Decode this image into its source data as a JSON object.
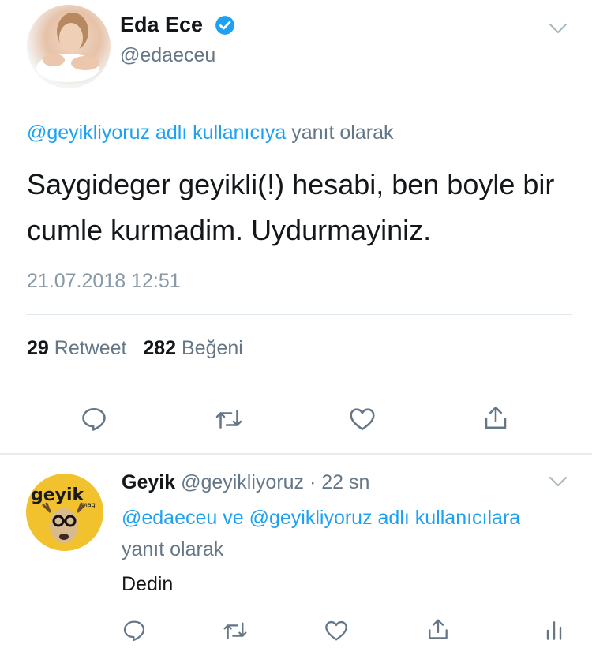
{
  "tweet": {
    "author_name": "Eda Ece",
    "author_handle": "@edaeceu",
    "reply_context_mention": "@geyikliyoruz adlı kullanıcıya",
    "reply_context_suffix": " yanıt olarak",
    "text": "Saygideger geyikli(!) hesabi, ben boyle bir cumle kurmadim. Uydurmayiniz.",
    "timestamp": "21.07.2018 12:51",
    "retweet_count": "29",
    "retweet_label": "Retweet",
    "like_count": "282",
    "like_label": "Beğeni",
    "actions": [
      "reply-icon",
      "retweet-icon",
      "like-icon",
      "share-icon"
    ]
  },
  "reply": {
    "author_name": "Geyik",
    "author_handle": "@geyikliyoruz",
    "time": "· 22 sn",
    "context_mention": "@edaeceu ve @geyikliyoruz adlı kullanıcılara",
    "context_suffix": " yanıt olarak",
    "text": "Dedin",
    "avatar_text": "geyik",
    "avatar_subtext": "mag",
    "actions": [
      "reply-icon",
      "retweet-icon",
      "like-icon",
      "share-icon",
      "analytics-icon"
    ]
  },
  "colors": {
    "link": "#1da1f2",
    "secondary": "#657786",
    "divider": "#e1e8ed",
    "verified": "#1da1f2",
    "reply_avatar_bg": "#f2c12e"
  }
}
